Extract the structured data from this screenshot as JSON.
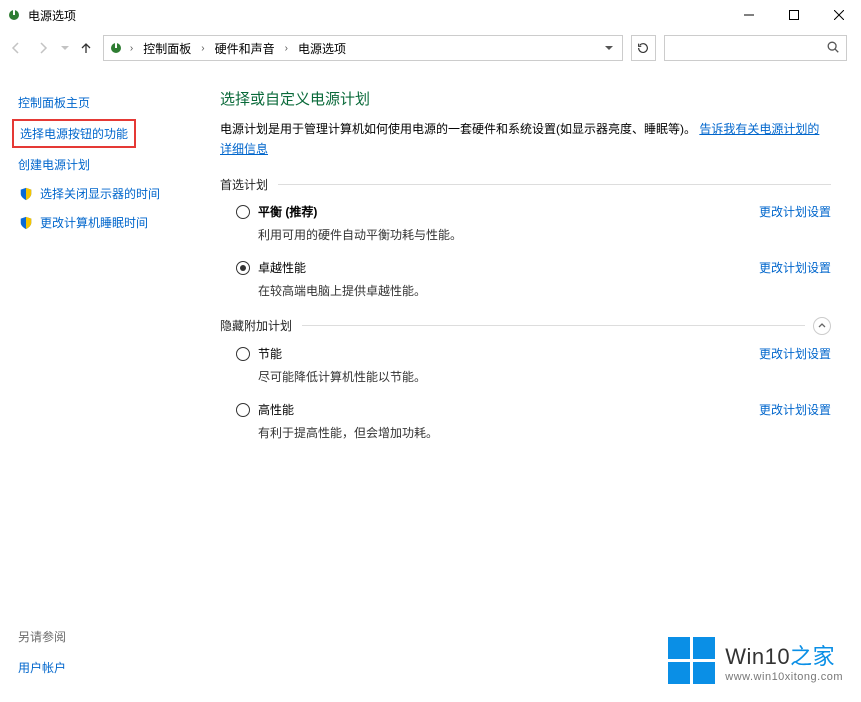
{
  "window": {
    "title": "电源选项"
  },
  "breadcrumb": {
    "root": "控制面板",
    "mid": "硬件和声音",
    "leaf": "电源选项"
  },
  "search": {
    "placeholder": ""
  },
  "sidebar": {
    "home": "控制面板主页",
    "choose_button": "选择电源按钮的功能",
    "create_plan": "创建电源计划",
    "display_off": "选择关闭显示器的时间",
    "sleep_time": "更改计算机睡眠时间",
    "see_also_label": "另请参阅",
    "user_accounts": "用户帐户"
  },
  "main": {
    "heading": "选择或自定义电源计划",
    "desc_text": "电源计划是用于管理计算机如何使用电源的一套硬件和系统设置(如显示器亮度、睡眠等)。",
    "desc_link": "告诉我有关电源计划的详细信息",
    "group_preferred": "首选计划",
    "group_hidden": "隐藏附加计划",
    "change_link": "更改计划设置",
    "plans_preferred": [
      {
        "title": "平衡 (推荐)",
        "desc": "利用可用的硬件自动平衡功耗与性能。",
        "checked": false,
        "bold": true
      },
      {
        "title": "卓越性能",
        "desc": "在较高端电脑上提供卓越性能。",
        "checked": true,
        "bold": false
      }
    ],
    "plans_hidden": [
      {
        "title": "节能",
        "desc": "尽可能降低计算机性能以节能。",
        "checked": false,
        "bold": false
      },
      {
        "title": "高性能",
        "desc": "有利于提高性能，但会增加功耗。",
        "checked": false,
        "bold": false
      }
    ]
  },
  "watermark": {
    "brand_main": "Win10",
    "brand_suffix": "之家",
    "url": "www.win10xitong.com"
  }
}
